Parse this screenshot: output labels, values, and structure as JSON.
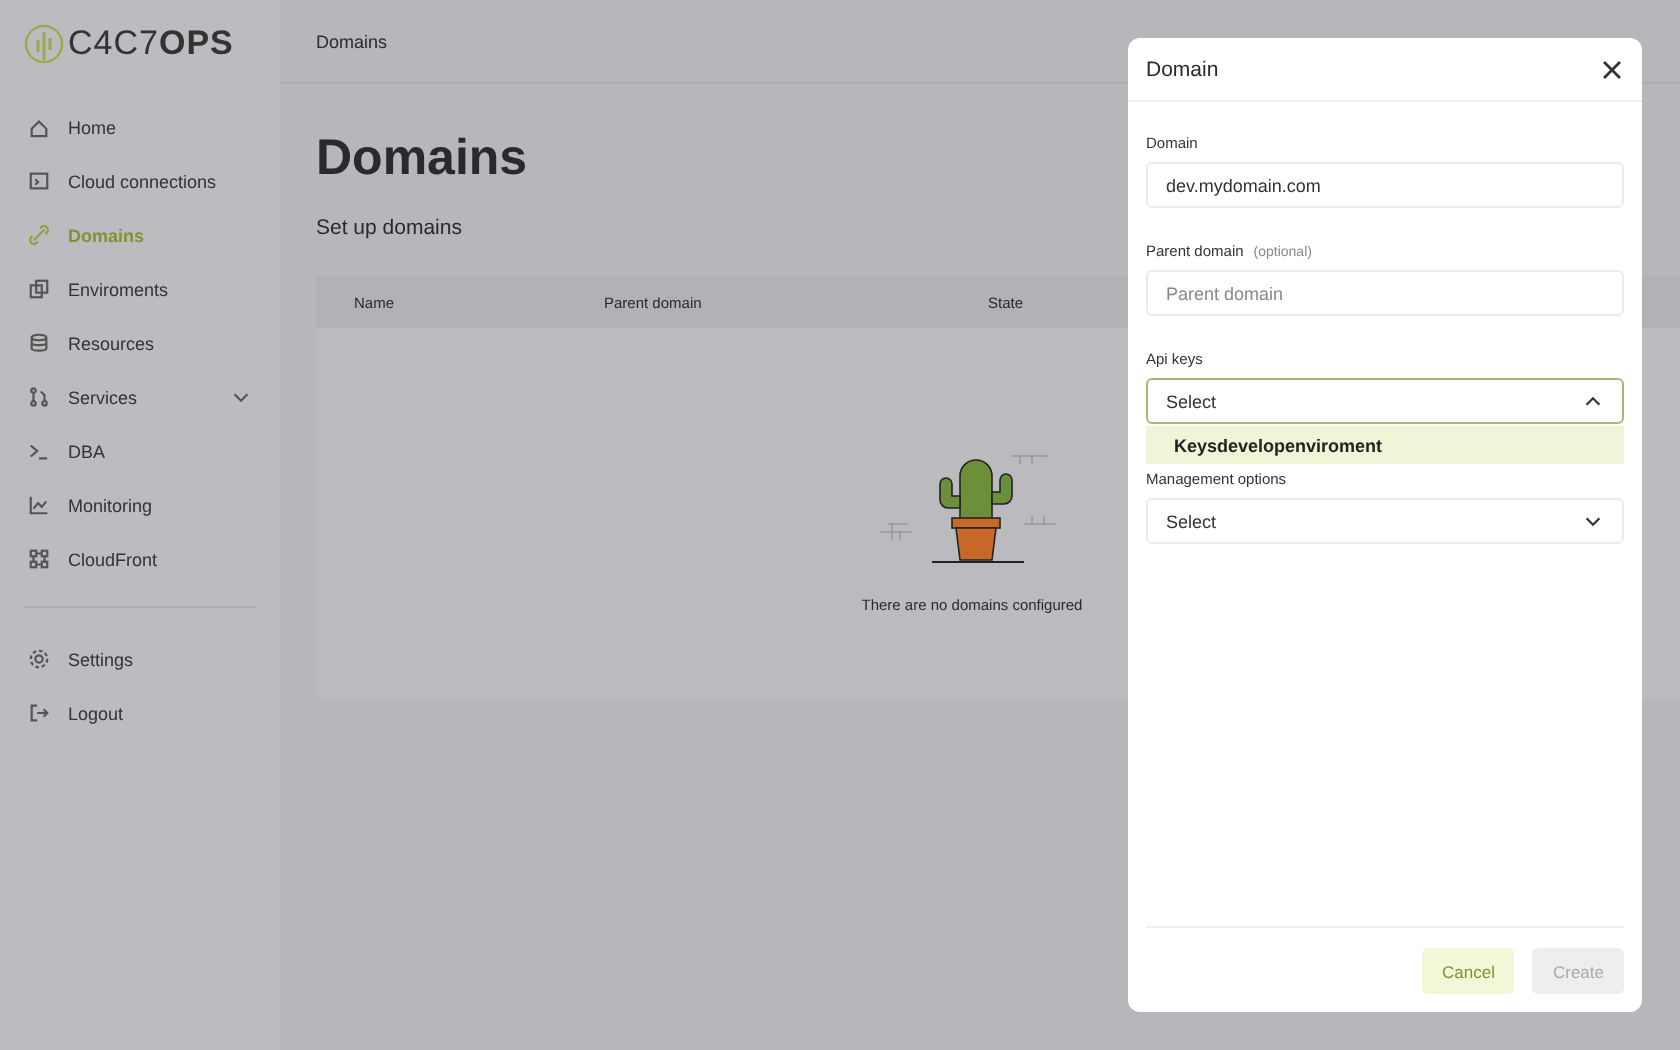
{
  "brand": {
    "logo_text": "C4C7**OPS**"
  },
  "header": {
    "breadcrumb": "Domains"
  },
  "sidebar": {
    "items": [
      {
        "label": "Home",
        "selected": false,
        "kind": "link"
      },
      {
        "label": "Cloud connections",
        "selected": false,
        "kind": "link"
      },
      {
        "label": "Domains",
        "selected": true,
        "kind": "link"
      },
      {
        "label": "Enviroments",
        "selected": false,
        "kind": "link"
      },
      {
        "label": "Resources",
        "selected": false,
        "kind": "link"
      },
      {
        "label": "Services",
        "selected": false,
        "kind": "group"
      },
      {
        "label": "DBA",
        "selected": false,
        "kind": "link"
      },
      {
        "label": "Monitoring",
        "selected": false,
        "kind": "link"
      },
      {
        "label": "CloudFront",
        "selected": false,
        "kind": "link"
      }
    ],
    "footer_items": [
      {
        "label": "Settings"
      },
      {
        "label": "Logout"
      }
    ]
  },
  "page": {
    "title": "Domains",
    "subtitle": "Set up domains",
    "table": {
      "columns": [
        "Name",
        "Parent domain",
        "State"
      ],
      "empty_text": "There are no domains configured"
    }
  },
  "modal": {
    "title": "Domain",
    "fields": [
      {
        "kind": "text",
        "label": "Domain",
        "value": "dev.mydomain.com"
      },
      {
        "kind": "text",
        "label": "Parent domain",
        "hint": "(optional)",
        "placeholder": "Parent domain"
      },
      {
        "kind": "select",
        "label": "Api keys",
        "value": "Select",
        "expanded": true,
        "options": [
          {
            "label": "Keysdevelopenviroment",
            "selected": false
          }
        ]
      },
      {
        "kind": "select",
        "label": "Management options",
        "value": "Select",
        "expanded": false
      }
    ],
    "buttons": [
      {
        "label": "Cancel",
        "kind": "secondary"
      },
      {
        "label": "Create",
        "kind": "primary",
        "disabled": true
      }
    ]
  }
}
